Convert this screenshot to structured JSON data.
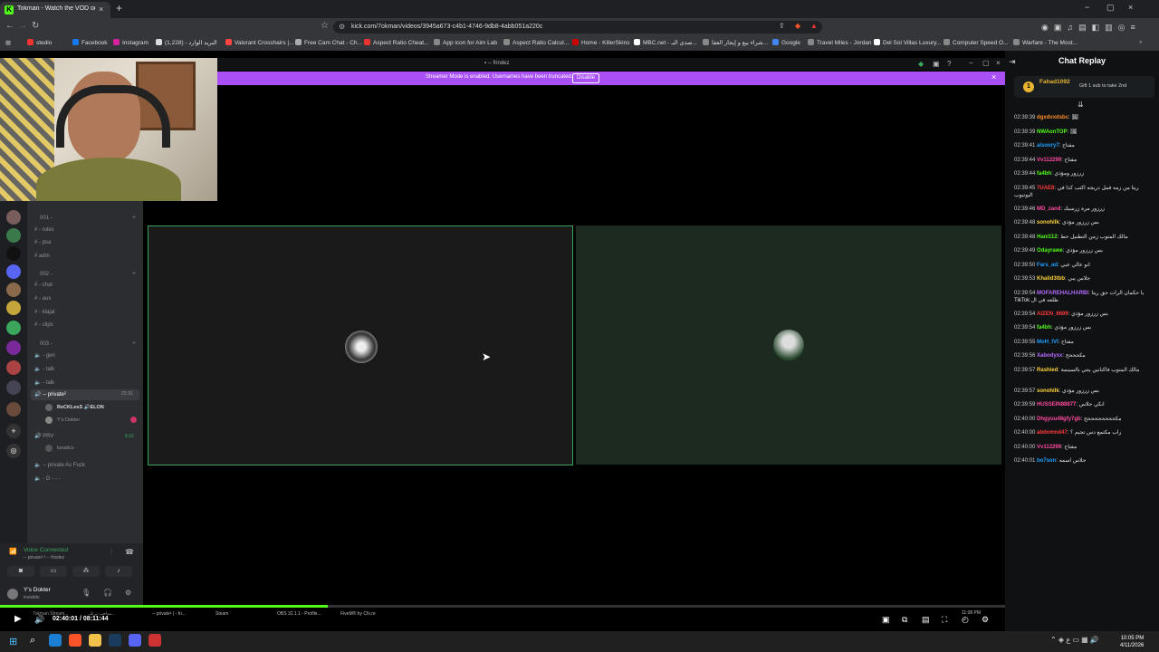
{
  "browser": {
    "tab_title": "Tokman - Watch the VOD on Ki",
    "tab_close": "×",
    "new_tab": "+",
    "url": "kick.com/7okman/videos/3945a673-c4b1-4746-9db8-4abb051a220c",
    "window_controls": [
      "−",
      "▢",
      "×"
    ],
    "bookmarks": [
      {
        "label": "stedio",
        "color": "#e33"
      },
      {
        "label": "Facebook",
        "color": "#1877f2"
      },
      {
        "label": "Instagram",
        "color": "#d6249f"
      },
      {
        "label": "البريد الوارد - (1,228)",
        "color": "#ddd"
      },
      {
        "label": "Valorant Crosshairs |...",
        "color": "#f44"
      },
      {
        "label": "Free Cam Chat - Ch...",
        "color": "#aaa"
      },
      {
        "label": "Aspect Ratio Cheat...",
        "color": "#e33"
      },
      {
        "label": "App icon for Aim Lab",
        "color": "#888"
      },
      {
        "label": "Aspect Ratio Calcul...",
        "color": "#888"
      },
      {
        "label": "Home - KillerSkins",
        "color": "#c00"
      },
      {
        "label": "MBC.net - صدى البـ...",
        "color": "#fff"
      },
      {
        "label": "شراء بيع و إيجار العقا...",
        "color": "#888"
      },
      {
        "label": "Google",
        "color": "#4285f4"
      },
      {
        "label": "Travel Miles - Jordan",
        "color": "#888"
      },
      {
        "label": "Del Sol Villas Luxury...",
        "color": "#fff"
      },
      {
        "label": "Computer Speed O...",
        "color": "#888"
      },
      {
        "label": "Warfare - The Most...",
        "color": "#888"
      }
    ]
  },
  "discord": {
    "window_title": "frindez",
    "banner_text": "Streamer Mode is enabled. Usernames have been truncated.",
    "banner_button": "Disable",
    "banner_close": "×",
    "channels": [
      {
        "label": "001 -",
        "type": "category"
      },
      {
        "label": "- rules",
        "type": "text"
      },
      {
        "label": "- psa",
        "type": "text"
      },
      {
        "label": "adm",
        "type": "text"
      },
      {
        "label": "002 -",
        "type": "category"
      },
      {
        "label": "- chat",
        "type": "text"
      },
      {
        "label": "- aux",
        "type": "text"
      },
      {
        "label": "- klajat",
        "type": "text"
      },
      {
        "label": "- clips",
        "type": "text"
      },
      {
        "label": "003 -",
        "type": "category"
      },
      {
        "label": "- gen",
        "type": "voice"
      },
      {
        "label": "- talk",
        "type": "voice"
      },
      {
        "label": "- talk",
        "type": "voice"
      },
      {
        "label": "-- private²",
        "type": "voice-active",
        "timer": "22:31"
      },
      {
        "label": "ReCKLesS 🔊ELON",
        "type": "member"
      },
      {
        "label": "Y's Dokter",
        "type": "member"
      },
      {
        "label": "PRV",
        "type": "voice",
        "timer": "8:16"
      },
      {
        "label": "lunatics",
        "type": "member"
      },
      {
        "label": "-- private As Fuck",
        "type": "voice"
      },
      {
        "label": "- G - - -",
        "type": "voice"
      }
    ],
    "voice_status": "Voice Connected",
    "voice_channel": "-- private² / -- frindez",
    "user_name": "Y's Dokter",
    "user_status": "invisible"
  },
  "player": {
    "time": "02:40:01 / 08:11:44",
    "progress": 0.326,
    "taskbar_items": [
      "7okman Stream...",
      "ساحب ترنك...",
      "-- private² | - fri...",
      "Steam",
      "OBS 32.1.1 - Profile...",
      "FiveM® by Cfx.re"
    ],
    "inner_clock": "11:08 PM"
  },
  "chat": {
    "title": "Chat Replay",
    "pinned_user": "Fahad1092",
    "pinned_text": "Gift 1 sub to take 2nd",
    "messages": [
      {
        "time": "02:39:39",
        "user": "dgxdvxdsbc",
        "color": "#ff8c2b",
        "text": "🖼"
      },
      {
        "time": "02:39:39",
        "user": "NWAonTOP",
        "color": "#53fc18",
        "text": "🖼"
      },
      {
        "time": "02:39:41",
        "user": "alsoory7",
        "color": "#1ea0ff",
        "text": "مفتاح"
      },
      {
        "time": "02:39:44",
        "user": "Vv112299",
        "color": "#ff4ba0",
        "text": "مفتاح"
      },
      {
        "time": "02:39:44",
        "user": "fa4bh",
        "color": "#53fc18",
        "text": "زرزور ومؤذي"
      },
      {
        "time": "02:39:45",
        "user": "7UAE8",
        "color": "#ff3b3b",
        "text": "ريتا من زمه فمل دريجه اكتب كذا في اليوتيوب"
      },
      {
        "time": "02:39:46",
        "user": "MD_zaod",
        "color": "#ff4ba0",
        "text": "زرزور مرة زرسيك"
      },
      {
        "time": "02:39:48",
        "user": "sonohilk",
        "color": "#ffd23b",
        "text": "بس زرزور مؤذي"
      },
      {
        "time": "02:39:48",
        "user": "Hani112",
        "color": "#53fc18",
        "text": "مالك المتوب زمن التطنيل حط"
      },
      {
        "time": "02:39:49",
        "user": "Odayrawe",
        "color": "#53fc18",
        "text": "بس زرزور مؤذي"
      },
      {
        "time": "02:39:50",
        "user": "Fars_ad",
        "color": "#1ea0ff",
        "text": "انو عالي عبي"
      },
      {
        "time": "02:39:53",
        "user": "Khalid3tbb",
        "color": "#ffd23b",
        "text": "جلاس يبي"
      },
      {
        "time": "02:39:54",
        "user": "MOFAREHALHARBI",
        "color": "#b56bff",
        "text": "يا حكمان الرات حق ريتا TikTok طلعه في ال"
      },
      {
        "time": "02:39:54",
        "user": "AIZEN_6699",
        "color": "#ff3b3b",
        "text": "بس زرزور مؤذي"
      },
      {
        "time": "02:39:54",
        "user": "fa4bh",
        "color": "#53fc18",
        "text": "بس زرزور مؤذي"
      },
      {
        "time": "02:39:55",
        "user": "MoH_IVI",
        "color": "#1ea0ff",
        "text": "مفتاح"
      },
      {
        "time": "02:39:56",
        "user": "Xabodyxx",
        "color": "#b56bff",
        "text": "مكحححح"
      },
      {
        "time": "02:39:57",
        "user": "Rashied",
        "color": "#ffd23b",
        "text": "مالك المتوب فاكتانين ينتي بالسينمة"
      },
      {
        "time": "02:39:57",
        "user": "sonohilk",
        "color": "#ffd23b",
        "text": "بس زرزور مؤذي"
      },
      {
        "time": "02:39:59",
        "user": "HUSSEIN88877",
        "color": "#ff4ba0",
        "text": "انكي جلاس"
      },
      {
        "time": "02:40:00",
        "user": "Dhgyuu48gfy7gb",
        "color": "#ff4ba0",
        "text": "مكححححححححح"
      },
      {
        "time": "02:40:00",
        "user": "abdomnd47",
        "color": "#ff3b3b",
        "text": "راب مكتمع دس تجيم ؟"
      },
      {
        "time": "02:40:00",
        "user": "Vv112299",
        "color": "#ff4ba0",
        "text": "مفتاح"
      },
      {
        "time": "02:40:01",
        "user": "bo7son",
        "color": "#1ea0ff",
        "text": "جلاس اسمه"
      }
    ]
  },
  "os": {
    "clock_time": "10:05 PM",
    "clock_date": "4/11/2026"
  }
}
